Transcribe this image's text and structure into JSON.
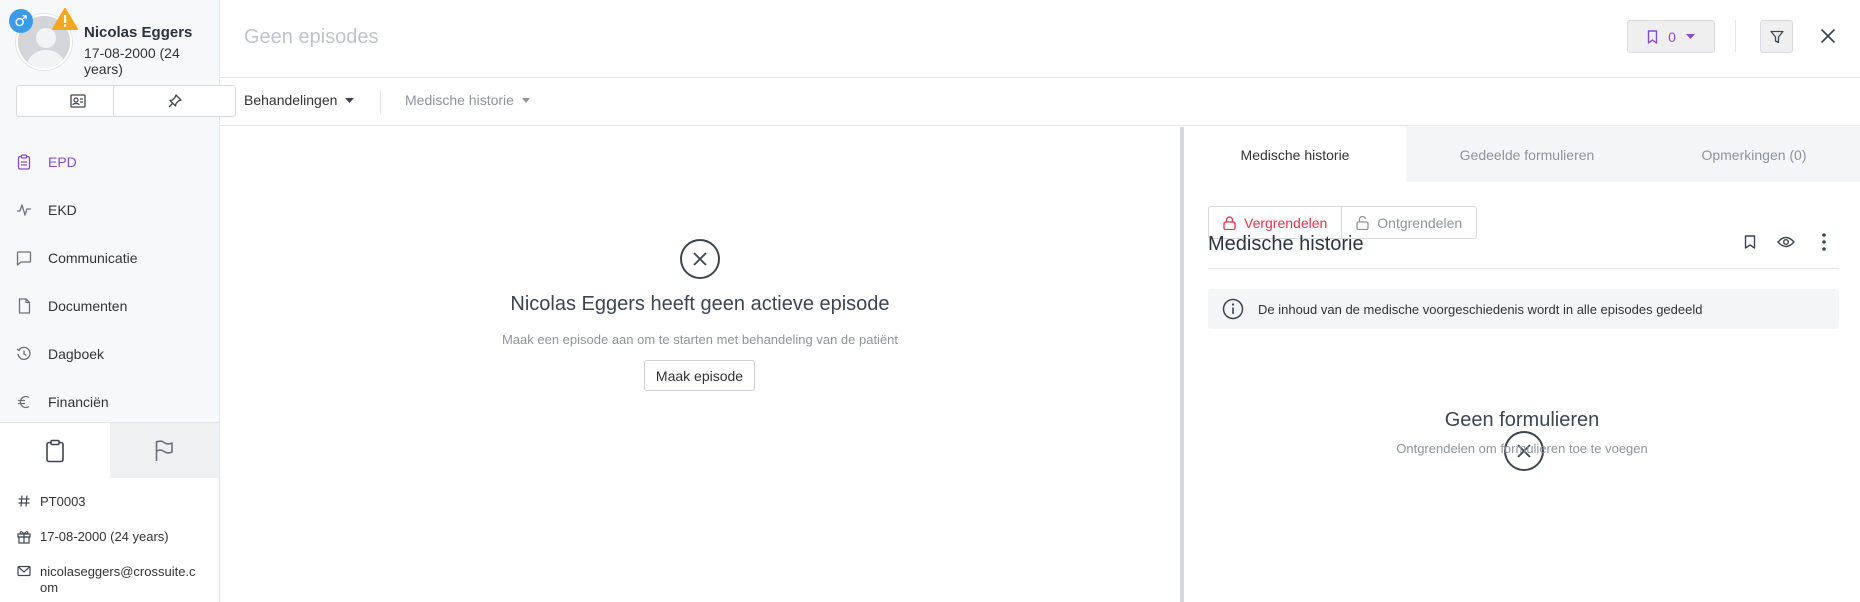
{
  "patient": {
    "name": "Nicolas Eggers",
    "dob": "17-08-2000 (24 years)",
    "gender_symbol": "♂"
  },
  "nav": {
    "items": [
      {
        "label": "EPD",
        "icon": "clipboard-icon",
        "active": true
      },
      {
        "label": "EKD",
        "icon": "activity-icon",
        "active": false
      },
      {
        "label": "Communicatie",
        "icon": "chat-icon",
        "active": false
      },
      {
        "label": "Documenten",
        "icon": "file-icon",
        "active": false
      },
      {
        "label": "Dagboek",
        "icon": "history-icon",
        "active": false
      },
      {
        "label": "Financiën",
        "icon": "euro-icon",
        "active": false
      }
    ]
  },
  "info": {
    "id": "PT0003",
    "birthday": "17-08-2000 (24 years)",
    "email_line1": "nicolaseggers@crossuite.c",
    "email_line2": "om"
  },
  "header": {
    "title": "Geen episodes",
    "bookmark_count": "0"
  },
  "subbar": {
    "treatments_label": "Behandelingen",
    "history_label": "Medische historie"
  },
  "main": {
    "title": "Nicolas Eggers heeft geen actieve episode",
    "subtitle": "Maak een episode aan om te starten met behandeling van de patiënt",
    "button_label": "Maak episode"
  },
  "panel": {
    "tabs": [
      {
        "label": "Medische historie",
        "active": true
      },
      {
        "label": "Gedeelde formulieren",
        "active": false
      },
      {
        "label": "Opmerkingen (0)",
        "active": false
      }
    ],
    "lock_label": "Vergrendelen",
    "unlock_label": "Ontgrendelen",
    "title": "Medische historie",
    "notice": "De inhoud van de medische voorgeschiedenis wordt in alle episodes gedeeld",
    "empty_title": "Geen formulieren",
    "empty_subtitle": "Ontgrendelen om formulieren toe te voegen"
  },
  "colors": {
    "accent": "#8a4bc7",
    "danger": "#e0344f",
    "warning": "#f5a623",
    "gender": "#3a9be8"
  }
}
